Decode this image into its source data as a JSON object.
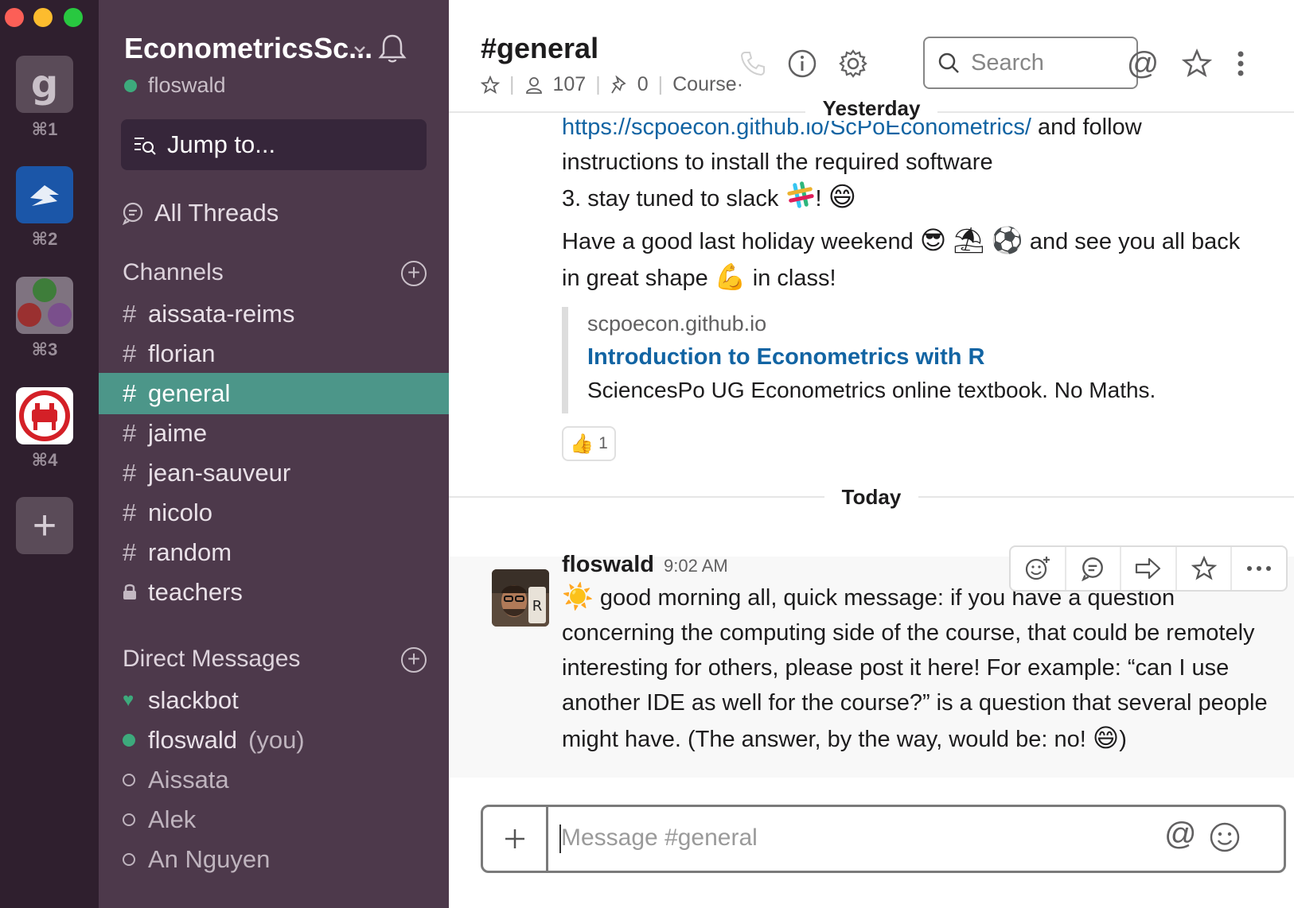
{
  "rail": {
    "workspaces": [
      {
        "letter": "g",
        "shortcut": "⌘1"
      },
      {
        "letter": "",
        "shortcut": "⌘2"
      },
      {
        "letter": "",
        "shortcut": "⌘3"
      },
      {
        "letter": "",
        "shortcut": "⌘4"
      }
    ],
    "add_label": "+"
  },
  "sidebar": {
    "team_name": "EconometricsSc...",
    "user": "floswald",
    "jump_to": "Jump to...",
    "all_threads": "All Threads",
    "channels_header": "Channels",
    "channels": [
      {
        "name": "aissata-reims",
        "prefix": "#"
      },
      {
        "name": "florian",
        "prefix": "#"
      },
      {
        "name": "general",
        "prefix": "#",
        "active": true
      },
      {
        "name": "jaime",
        "prefix": "#"
      },
      {
        "name": "jean-sauveur",
        "prefix": "#"
      },
      {
        "name": "nicolo",
        "prefix": "#"
      },
      {
        "name": "random",
        "prefix": "#"
      },
      {
        "name": "teachers",
        "prefix": "lock"
      }
    ],
    "dm_header": "Direct Messages",
    "dms": [
      {
        "name": "slackbot",
        "status": "heart"
      },
      {
        "name": "floswald",
        "status": "online",
        "suffix": "(you)"
      },
      {
        "name": "Aissata",
        "status": "offline"
      },
      {
        "name": "Alek",
        "status": "offline"
      },
      {
        "name": "An Nguyen",
        "status": "offline"
      }
    ]
  },
  "header": {
    "title": "#general",
    "members": "107",
    "pins": "0",
    "topic": "Course·",
    "search_placeholder": "Search"
  },
  "messages": {
    "yesterday_label": "Yesterday",
    "today_label": "Today",
    "prev_link": "https://scpoecon.github.io/ScPoEconometrics/",
    "prev_line1_after": "and follow",
    "prev_line2": "instructions to install the required software",
    "prev_line3": "3. stay tuned to slack",
    "prev_para_a": "Have a good last holiday weekend",
    "prev_para_b": "and see you all back",
    "prev_para_c": "in great shape",
    "prev_para_d": "in class!",
    "attachment": {
      "site": "scpoecon.github.io",
      "title": "Introduction to Econometrics with R",
      "description": "SciencesPo UG Econometrics online textbook. No Maths."
    },
    "reaction": {
      "emoji": "👍",
      "count": "1"
    },
    "today": {
      "author": "floswald",
      "time": "9:02 AM",
      "line1": "good morning all, quick message: if you have a question",
      "line2": "concerning the computing side of the course, that could be remotely",
      "line3": "interesting for others, please post it here! For example: “can I use",
      "line4": "another IDE as well for the course?” is a question that several people",
      "line5": "might have. (The answer, by the way, would be: no!"
    }
  },
  "composer": {
    "placeholder": "Message #general"
  },
  "colors": {
    "rail_bg": "#2f1f2e",
    "sidebar_bg": "#4d394b",
    "active_channel": "#4c9689",
    "online": "#3daa7c",
    "link": "#1264a3"
  }
}
